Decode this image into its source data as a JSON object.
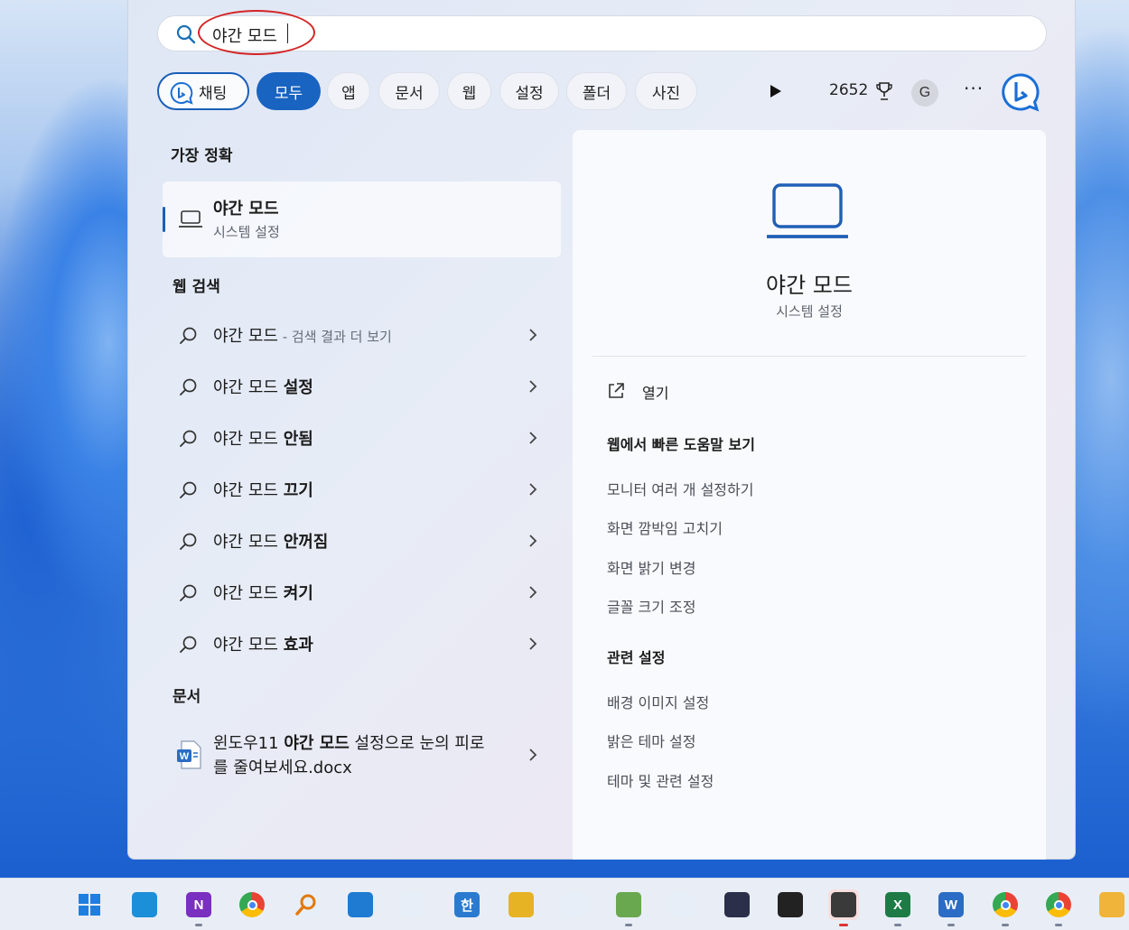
{
  "search": {
    "query": "야간 모드"
  },
  "filters": {
    "chat_label": "채팅",
    "chips": [
      "모두",
      "앱",
      "문서",
      "웹",
      "설정",
      "폴더",
      "사진"
    ],
    "points": "2652",
    "avatar_letter": "G",
    "more": "···"
  },
  "left": {
    "best_match_heading": "가장 정확",
    "best_match": {
      "title": "야간 모드",
      "subtitle": "시스템 설정"
    },
    "web_heading": "웹 검색",
    "web_results": [
      {
        "base": "야간 모드",
        "suffix": "",
        "sub": " - 검색 결과 더 보기"
      },
      {
        "base": "야간 모드 ",
        "suffix": "설정",
        "sub": ""
      },
      {
        "base": "야간 모드 ",
        "suffix": "안됨",
        "sub": ""
      },
      {
        "base": "야간 모드 ",
        "suffix": "끄기",
        "sub": ""
      },
      {
        "base": "야간 모드 ",
        "suffix": "안꺼짐",
        "sub": ""
      },
      {
        "base": "야간 모드 ",
        "suffix": "켜기",
        "sub": ""
      },
      {
        "base": "야간 모드 ",
        "suffix": "효과",
        "sub": ""
      }
    ],
    "docs_heading": "문서",
    "doc": {
      "pre": "윈도우11 ",
      "bold": "야간 모드",
      "post": " 설정으로 눈의 피로를 줄여보세요.docx"
    }
  },
  "detail": {
    "title": "야간 모드",
    "subtitle": "시스템 설정",
    "open_label": "열기",
    "web_help_heading": "웹에서 빠른 도움말 보기",
    "web_help_links": [
      "모니터 여러 개 설정하기",
      "화면 깜박임 고치기",
      "화면 밝기 변경",
      "글꼴 크기 조정"
    ],
    "related_heading": "관련 설정",
    "related_links": [
      "배경 이미지 설정",
      "밝은 테마 설정",
      "테마 및 관련 설정"
    ]
  },
  "taskbar": {
    "icons": [
      "windows-start-icon",
      "edge-icon",
      "onenote-icon",
      "chrome-icon",
      "search-magnifier-app-icon",
      "vscode-icon",
      "office-app-icon",
      "hancom-icon",
      "audio-app-icon",
      "pen-app-icon",
      "notepad-icon",
      "text-app-icon",
      "eclipse-icon",
      "obs-icon",
      "sticky-notes-icon",
      "excel-icon",
      "word-icon",
      "chrome-profile-icon",
      "chrome-profile-2-icon",
      "file-explorer-icon"
    ],
    "letters": [
      "",
      "",
      "N",
      "",
      "",
      "",
      "",
      "한",
      "",
      "",
      "",
      "",
      "",
      "",
      "",
      "X",
      "W",
      "",
      "",
      ""
    ]
  },
  "colors": {
    "accent": "#1963c1",
    "annotation": "#d42424"
  }
}
